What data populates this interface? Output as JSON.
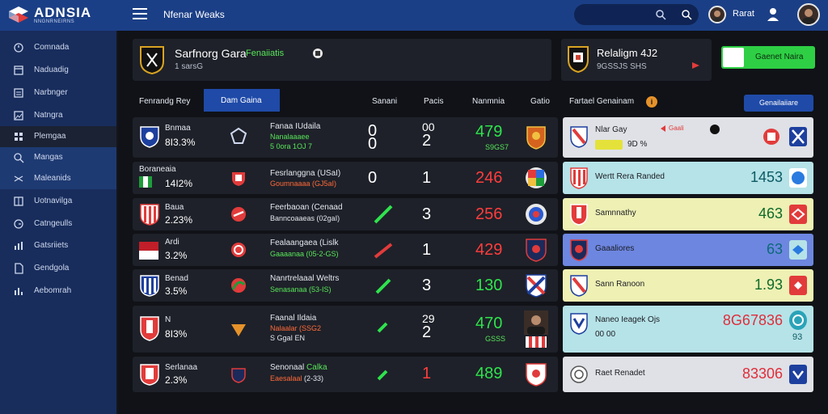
{
  "app": {
    "brand": "ADNSIA",
    "brand_sub": "NNGNRNEIRNS",
    "title": "Nfenar Weaks",
    "user_name": "Rarat"
  },
  "sidebar": {
    "items": [
      {
        "label": "Comnada",
        "icon": "clock-icon"
      },
      {
        "label": "Naduadig",
        "icon": "calendar-icon"
      },
      {
        "label": "Narbnger",
        "icon": "list-icon"
      },
      {
        "label": "Natngra",
        "icon": "image-icon"
      },
      {
        "label": "Plemgaa",
        "icon": "grid-icon"
      },
      {
        "label": "Mangas",
        "icon": "search-icon"
      },
      {
        "label": "Maleanids",
        "icon": "shuffle-icon"
      },
      {
        "label": "Uotnavilga",
        "icon": "table-icon"
      },
      {
        "label": "Catngeulls",
        "icon": "clock-icon"
      },
      {
        "label": "Gatsriiets",
        "icon": "chart-icon"
      },
      {
        "label": "Gendgola",
        "icon": "document-icon"
      },
      {
        "label": "Aebomrah",
        "icon": "chart-icon"
      }
    ],
    "active_index": 4
  },
  "header": {
    "match_title": "Sarfnorg Gara",
    "match_tag": "Fenaiiatis",
    "match_sub": "1 sarsG",
    "side_title": "Relaligm 4J2",
    "side_sub": "9GSSJS SHS",
    "cta_label": "Gaenet Naira"
  },
  "columns": {
    "col1": "Fenrandg Rey",
    "tab_active": "Dam Gaina",
    "col3": "Sanani",
    "col4": "Pacis",
    "col5": "Nanmnia",
    "col6": "Gatio",
    "col7": "Fartael Genainam",
    "details_button": "Genailaiiare"
  },
  "rows": [
    {
      "team": "Bnmaa",
      "pct": "8I3.3%",
      "match": "Fanaa IUdaila",
      "match_sub": "Nanalaaaee",
      "match_sub2": "5 0ora 1OJ 7",
      "num": "0",
      "num2": "0",
      "goal": "00",
      "goal2": "2",
      "score": "479",
      "score_color": "green",
      "score_sub": "S9GS7"
    },
    {
      "team": "Boraneaia",
      "pct": "14I2%",
      "match": "Fesrlanggna (USaI)",
      "match_sub": "Goumnaaaa (GJ5aI)",
      "num": "0",
      "goal": "1",
      "score": "246",
      "score_color": "red"
    },
    {
      "team": "Baua",
      "pct": "2.23%",
      "match": "Feerbaoan (Cenaad",
      "match_sub": "Banncoaaeas (02gaI)",
      "num": "",
      "goal": "3",
      "score": "256",
      "score_color": "red"
    },
    {
      "team": "Ardi",
      "pct": "3.2%",
      "match": "Fealaangaea (Lislk",
      "match_sub": "Gaaaanaa (05-2-GS)",
      "num": "",
      "goal": "1",
      "score": "429",
      "score_color": "red"
    },
    {
      "team": "Benad",
      "pct": "3.5%",
      "match": "Nanrtrelaaal Weltrs",
      "match_sub": "Senasanaa (53-IS)",
      "num": "",
      "goal": "3",
      "score": "130",
      "score_color": "green"
    },
    {
      "team": "N",
      "pct": "8I3%",
      "match": "Faanal Ildaia",
      "match_sub": "Nalaalar (SSG2",
      "match_sub2": "S GgaI EN",
      "num": "",
      "goal": "29",
      "goal2": "2",
      "score": "470",
      "score_color": "green",
      "score_sub": "GSSS"
    },
    {
      "team": "Serlanaa",
      "pct": "2.3%",
      "match": "Senonaal",
      "match_tag": "Calka",
      "match_sub": "Eaesalaal",
      "match_sub2": "(2-33)",
      "num": "",
      "goal": "1",
      "score": "489",
      "score_color": "green"
    }
  ],
  "panels": [
    {
      "label": "Nlar Gay",
      "label2": "Gaali",
      "sub": "9D %",
      "value": "",
      "bg": "#dfe1e6"
    },
    {
      "label": "Wertt Rera Randed",
      "value": "1453",
      "value_color": "#0c5a63",
      "bg": "#b6e3e8"
    },
    {
      "label": "Samnnathy",
      "value": "463",
      "value_color": "#0e6a2a",
      "bg": "#eef0b4"
    },
    {
      "label": "Gaaaliores",
      "value": "63",
      "value_color": "#0c6a78",
      "bg": "#6d86e0"
    },
    {
      "label": "Sann Ranoon",
      "value": "1.93",
      "value_color": "#0e6a2a",
      "bg": "#eef0b4"
    },
    {
      "label": "Naneo Ieagek Ojs",
      "sub": "00 00",
      "value": "8G67836",
      "value2": "93",
      "value_color": "#e02d3a",
      "bg": "#b6e3e8"
    },
    {
      "label": "Raet Renadet",
      "value": "83306",
      "value_color": "#e02d3a",
      "bg": "#dfe1e6"
    }
  ],
  "colors": {
    "topbar": "#1b3f86",
    "sidebar": "#182d5c",
    "accent": "#1f4aa8",
    "green": "#2fe34d",
    "red": "#ff3d3d"
  }
}
